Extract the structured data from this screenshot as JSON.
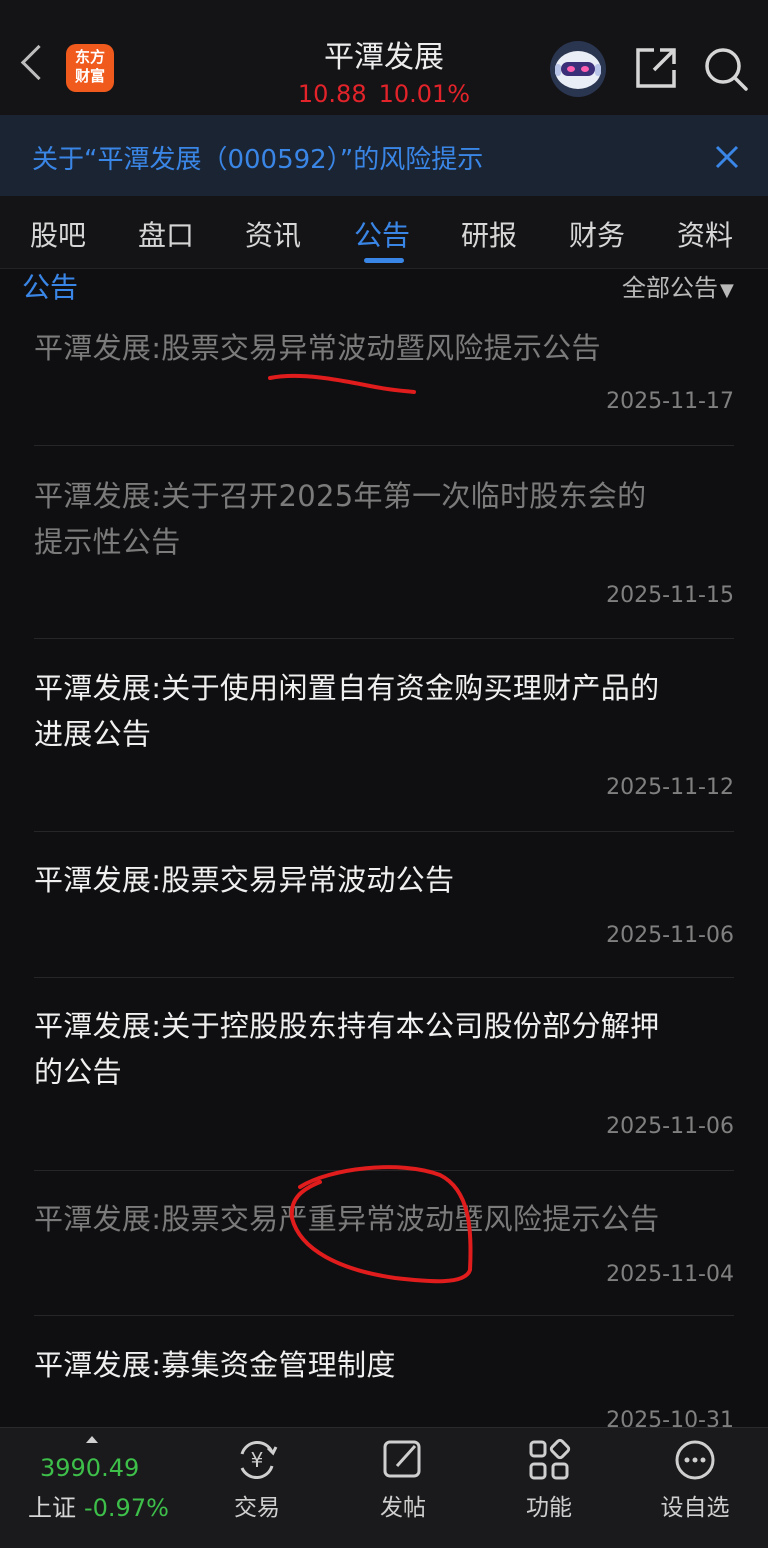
{
  "header": {
    "logo_text_line1": "东方",
    "logo_text_line2": "财富",
    "stock_name": "平潭发展",
    "price": "10.88",
    "change_pct": "10.01%"
  },
  "banner": {
    "text": "关于“平潭发展（000592）”的风险提示"
  },
  "tabs": [
    {
      "label": "股吧"
    },
    {
      "label": "盘口"
    },
    {
      "label": "资讯"
    },
    {
      "label": "公告"
    },
    {
      "label": "研报"
    },
    {
      "label": "财务"
    },
    {
      "label": "资料"
    }
  ],
  "section": {
    "title": "公告",
    "filter_label": "全部公告",
    "filter_arrow": "▼"
  },
  "announcements": [
    {
      "line1": "平潭发展:股票交易异常波动暨风险提示公告",
      "line2": "",
      "date": "2025-11-17"
    },
    {
      "line1": "平潭发展:关于召开2025年第一次临时股东会的",
      "line2": "提示性公告",
      "date": "2025-11-15"
    },
    {
      "line1": "平潭发展:关于使用闲置自有资金购买理财产品的",
      "line2": "进展公告",
      "date": "2025-11-12"
    },
    {
      "line1": "平潭发展:股票交易异常波动公告",
      "line2": "",
      "date": "2025-11-06"
    },
    {
      "line1": "平潭发展:关于控股股东持有本公司股份部分解押",
      "line2": "的公告",
      "date": "2025-11-06"
    },
    {
      "line1": "平潭发展:股票交易严重异常波动暨风险提示公告",
      "line2": "",
      "date": "2025-11-04"
    },
    {
      "line1": "平潭发展:募集资金管理制度",
      "line2": "",
      "date": "2025-10-31"
    }
  ],
  "bottom_nav": {
    "index_value": "3990.49",
    "index_name": "上证",
    "index_change": "-0.97%",
    "items": [
      {
        "label": "交易",
        "icon": "yuan-exchange-icon"
      },
      {
        "label": "发帖",
        "icon": "edit-post-icon"
      },
      {
        "label": "功能",
        "icon": "grid-function-icon"
      },
      {
        "label": "设自选",
        "icon": "more-dots-icon"
      }
    ]
  },
  "colors": {
    "accent_blue": "#3a86e6",
    "up_red": "#e2232a",
    "down_green": "#3dbf4a",
    "annotation_red": "#e01c1c"
  }
}
